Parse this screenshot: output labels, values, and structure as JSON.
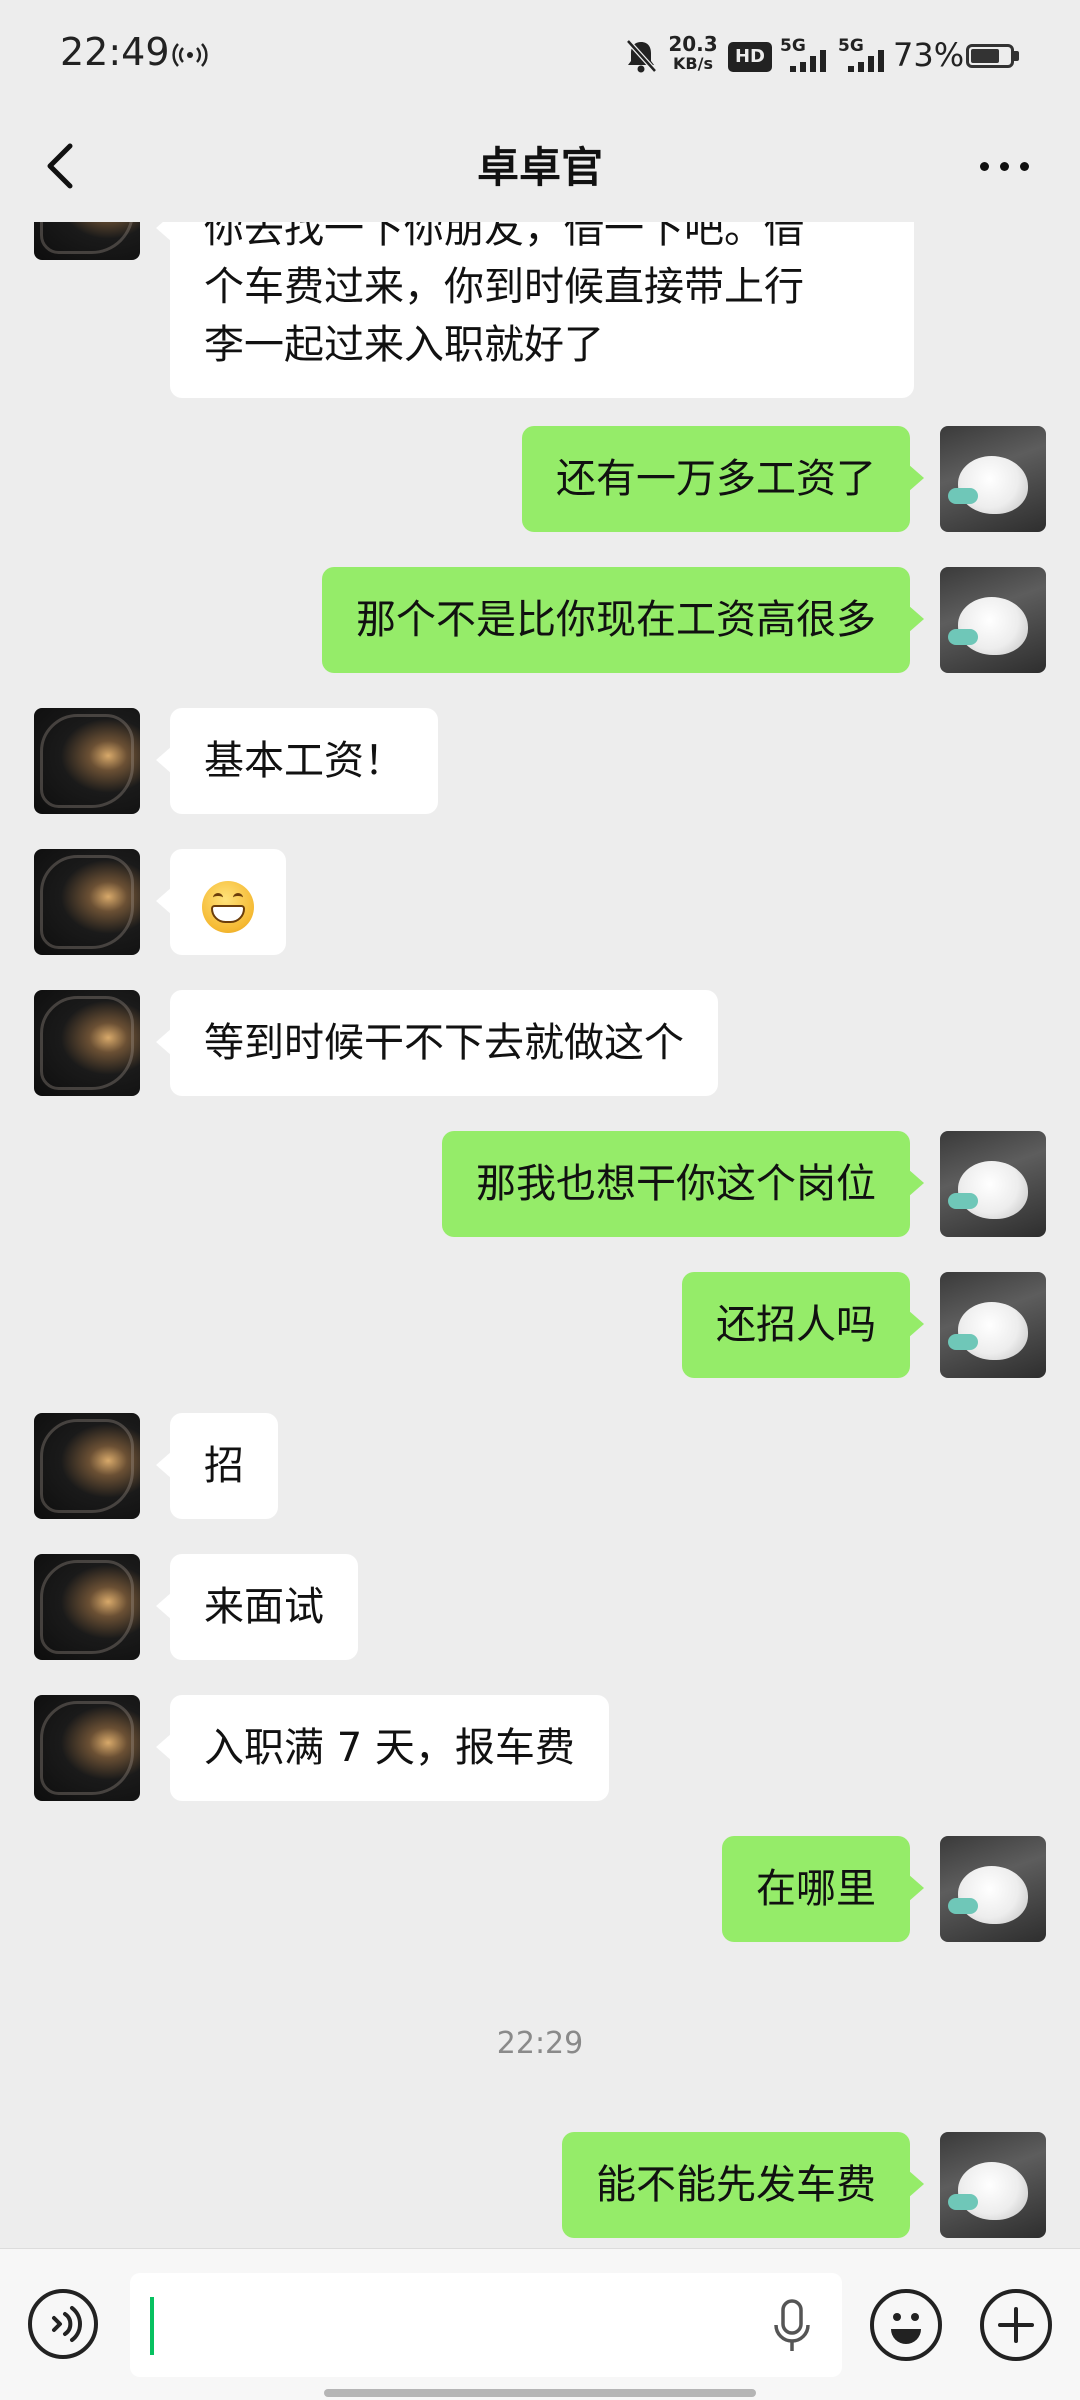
{
  "status_bar": {
    "time": "22:49",
    "net_speed_value": "20.3",
    "net_speed_unit": "KB/s",
    "hd_badge": "HD",
    "signal1": "5G",
    "signal2": "5G",
    "battery_percent": "73%",
    "battery_level": 0.73
  },
  "header": {
    "title": "卓卓官"
  },
  "messages": [
    {
      "side": "left",
      "lines": [
        "你去找一下你朋友，借一下吧。借",
        "个车费过来，你到时候直接带上行",
        "李一起过来入职就好了"
      ]
    },
    {
      "side": "right",
      "text": "还有一万多工资了"
    },
    {
      "side": "right",
      "text": "那个不是比你现在工资高很多"
    },
    {
      "side": "left",
      "text": "基本工资！"
    },
    {
      "side": "left",
      "emoji": "grinning-face"
    },
    {
      "side": "left",
      "text": "等到时候干不下去就做这个"
    },
    {
      "side": "right",
      "text": "那我也想干你这个岗位"
    },
    {
      "side": "right",
      "text": "还招人吗"
    },
    {
      "side": "left",
      "text": "招"
    },
    {
      "side": "left",
      "text": "来面试"
    },
    {
      "side": "left",
      "text": "入职满 7 天，报车费"
    },
    {
      "side": "right",
      "text": "在哪里"
    },
    {
      "side": "right",
      "text": "能不能先发车费"
    }
  ],
  "timestamp": "22:29",
  "input_bar": {
    "value": ""
  },
  "icons": {
    "back": "back-arrow-icon",
    "more": "more-icon",
    "voice": "voice-icon",
    "mic": "mic-icon",
    "emoji": "emoji-icon",
    "plus": "plus-icon"
  },
  "colors": {
    "sent_bubble": "#95ec69",
    "received_bubble": "#ffffff",
    "background": "#ededed",
    "caret": "#07c160"
  }
}
